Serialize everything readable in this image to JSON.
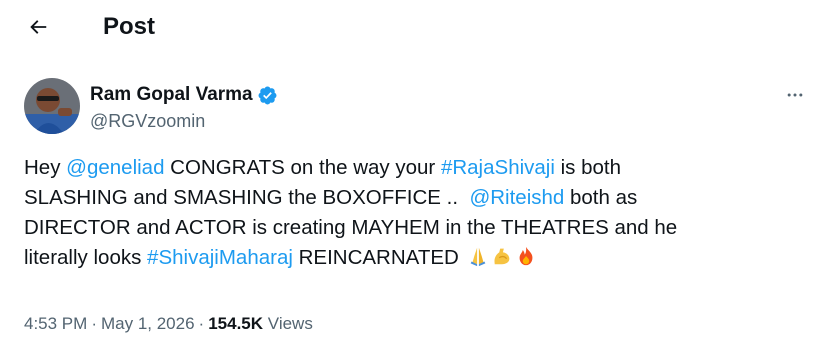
{
  "header": {
    "title": "Post",
    "back_icon": "arrow-left-icon"
  },
  "author": {
    "name": "Ram Gopal Varma",
    "handle": "@RGVzoomin",
    "verified_color": "#1d9bf0"
  },
  "tweet": {
    "line1": {
      "t1": "Hey ",
      "mention1": "@geneliad",
      "t2": " CONGRATS on the way your ",
      "hashtag1": "#RajaShivaji",
      "t3": " is both"
    },
    "line2": {
      "t1": "SLASHING and SMASHING the BOXOFFICE ..  ",
      "mention2": "@Riteishd",
      "t2": " both as"
    },
    "line3": {
      "t1": "DIRECTOR and ACTOR is creating MAYHEM in the THEATRES and he"
    },
    "line4": {
      "t1": "literally looks ",
      "hashtag2": "#ShivajiMaharaj",
      "t2": " REINCARNATED "
    },
    "emojis": [
      "folded-hands-icon",
      "flexed-biceps-icon",
      "fire-icon"
    ],
    "link_color": "#1d9bf0"
  },
  "meta": {
    "time": "4:53 PM",
    "date": "May 1, 2026",
    "views_count": "154.5K",
    "views_label": "Views",
    "separator": "·"
  }
}
